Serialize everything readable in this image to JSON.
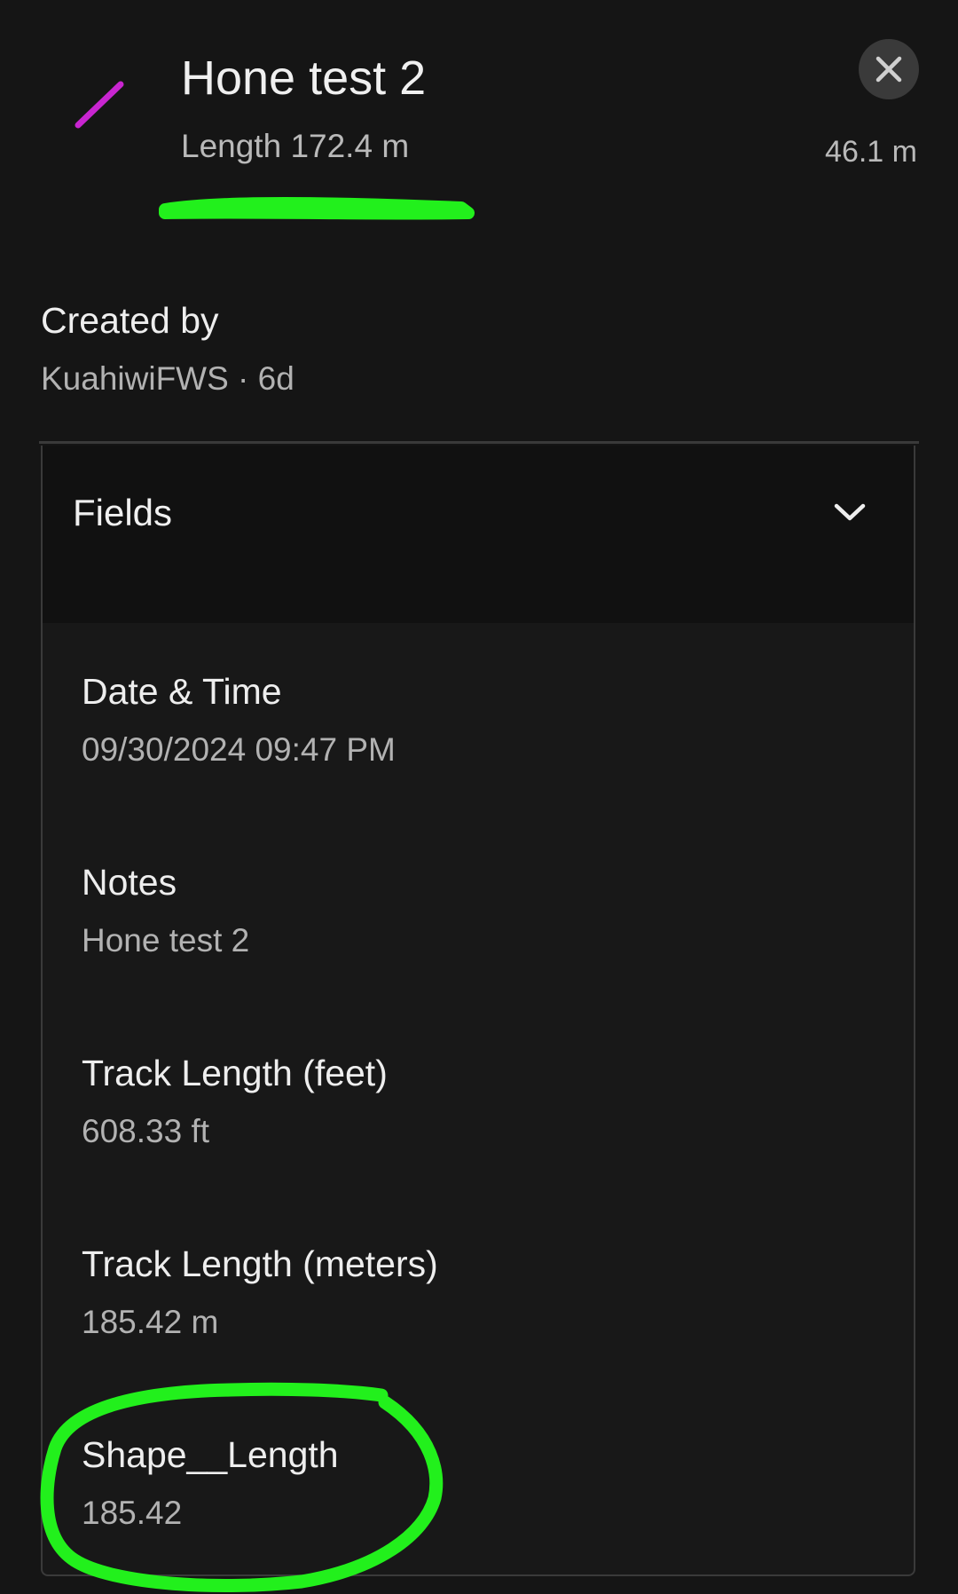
{
  "header": {
    "title": "Hone test 2",
    "subtitle": "Length 172.4 m",
    "distance": "46.1 m",
    "line_icon_color": "#c825d0",
    "close_icon": "close-icon"
  },
  "created": {
    "label": "Created by",
    "value": "KuahiwiFWS · 6d"
  },
  "fields": {
    "title": "Fields",
    "toggle_icon": "chevron-down-icon",
    "items": [
      {
        "label": "Date & Time",
        "value": "09/30/2024 09:47 PM"
      },
      {
        "label": "Notes",
        "value": "Hone test 2"
      },
      {
        "label": "Track Length (feet)",
        "value": "608.33 ft"
      },
      {
        "label": "Track Length (meters)",
        "value": "185.42 m"
      },
      {
        "label": "Shape__Length",
        "value": "185.42"
      }
    ]
  },
  "annotations": {
    "highlight_color": "#22f01c"
  }
}
